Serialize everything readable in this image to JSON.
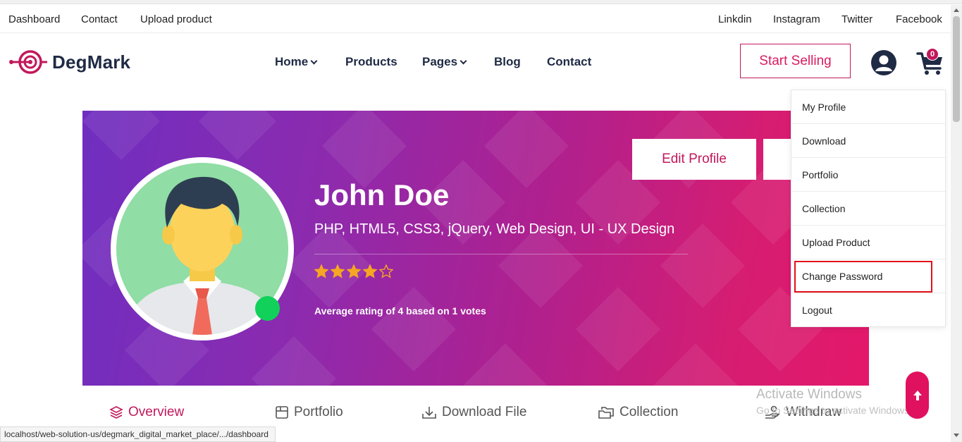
{
  "topbar": {
    "left_links": [
      "Dashboard",
      "Contact",
      "Upload product"
    ],
    "social_links": [
      "Linkdin",
      "Instagram",
      "Twitter",
      "Facebook"
    ]
  },
  "header": {
    "logo_text": "DegMark",
    "nav": [
      {
        "label": "Home",
        "has_dropdown": true
      },
      {
        "label": "Products",
        "has_dropdown": false
      },
      {
        "label": "Pages",
        "has_dropdown": true
      },
      {
        "label": "Blog",
        "has_dropdown": false
      },
      {
        "label": "Contact",
        "has_dropdown": false
      }
    ],
    "start_selling_label": "Start Selling",
    "cart_count": "0",
    "icons": [
      "user-icon",
      "cart-icon"
    ]
  },
  "profile": {
    "name": "John Doe",
    "skills": "PHP, HTML5, CSS3, jQuery, Web Design, UI - UX Design",
    "rating": 4,
    "rating_max": 5,
    "rating_text": "Average rating of 4 based on 1 votes",
    "edit_profile_label": "Edit Profile",
    "online": true
  },
  "user_menu": {
    "items": [
      "My Profile",
      "Download",
      "Portfolio",
      "Collection",
      "Upload Product",
      "Change Password",
      "Logout"
    ],
    "highlighted": "Change Password"
  },
  "tabs": [
    {
      "label": "Overview",
      "icon": "layers-icon",
      "active": true
    },
    {
      "label": "Portfolio",
      "icon": "portfolio-icon",
      "active": false
    },
    {
      "label": "Download File",
      "icon": "download-icon",
      "active": false
    },
    {
      "label": "Collection",
      "icon": "folders-icon",
      "active": false
    },
    {
      "label": "Withdraw",
      "icon": "withdraw-icon",
      "active": false
    }
  ],
  "watermark": {
    "line1": "Activate Windows",
    "line2": "Go to Settings to activate Windows."
  },
  "status_bar": {
    "url": "localhost/web-solution-us/degmark_digital_market_place/.../dashboard"
  },
  "colors": {
    "brand": "#c2185b",
    "navy": "#1f2a44",
    "online": "#11d15a",
    "star": "#f5a623",
    "highlight_border": "#e0101a"
  }
}
